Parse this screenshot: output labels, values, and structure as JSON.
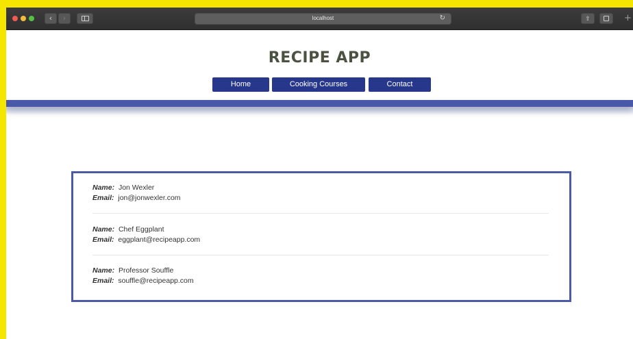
{
  "browser": {
    "url": "localhost",
    "reload_icon": "reload-icon",
    "back_icon": "chevron-left-icon",
    "forward_icon": "chevron-right-icon",
    "share_icon": "share-icon",
    "tabs_icon": "tabs-icon",
    "new_tab_icon": "plus-icon"
  },
  "header": {
    "title": "RECIPE APP",
    "nav": [
      {
        "label": "Home"
      },
      {
        "label": "Cooking Courses"
      },
      {
        "label": "Contact"
      }
    ]
  },
  "subscribers": {
    "name_label": "Name:",
    "email_label": "Email:",
    "items": [
      {
        "name": "Jon Wexler",
        "email": "jon@jonwexler.com"
      },
      {
        "name": "Chef Eggplant",
        "email": "eggplant@recipeapp.com"
      },
      {
        "name": "Professor Souffle",
        "email": "souffle@recipeapp.com"
      }
    ]
  },
  "colors": {
    "accent": "#27388c",
    "band": "#4a58a8",
    "title": "#4b5240",
    "frame": "#f5e600"
  }
}
